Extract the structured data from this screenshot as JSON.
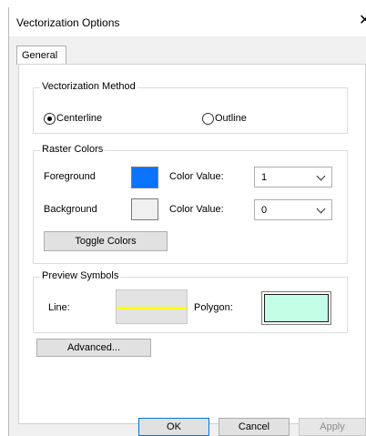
{
  "window": {
    "title": "Vectorization Options",
    "close_glyph": "✕"
  },
  "tabs": [
    {
      "label": "General"
    }
  ],
  "vectorization_method": {
    "group_label": "Vectorization Method",
    "options": [
      {
        "label": "Centerline",
        "selected": true
      },
      {
        "label": "Outline",
        "selected": false
      }
    ]
  },
  "raster_colors": {
    "group_label": "Raster Colors",
    "foreground": {
      "label": "Foreground",
      "swatch_color": "#0a74ff",
      "color_value_label": "Color Value:",
      "value": "1"
    },
    "background": {
      "label": "Background",
      "swatch_color": "#f0f0f0",
      "color_value_label": "Color Value:",
      "value": "0"
    },
    "toggle_label": "Toggle Colors"
  },
  "preview_symbols": {
    "group_label": "Preview Symbols",
    "line_label": "Line:",
    "line_color": "#ffff00",
    "polygon_label": "Polygon:",
    "polygon_fill": "#c3ffe6"
  },
  "advanced_label": "Advanced...",
  "footer": {
    "ok_label": "OK",
    "cancel_label": "Cancel",
    "apply_label": "Apply"
  }
}
